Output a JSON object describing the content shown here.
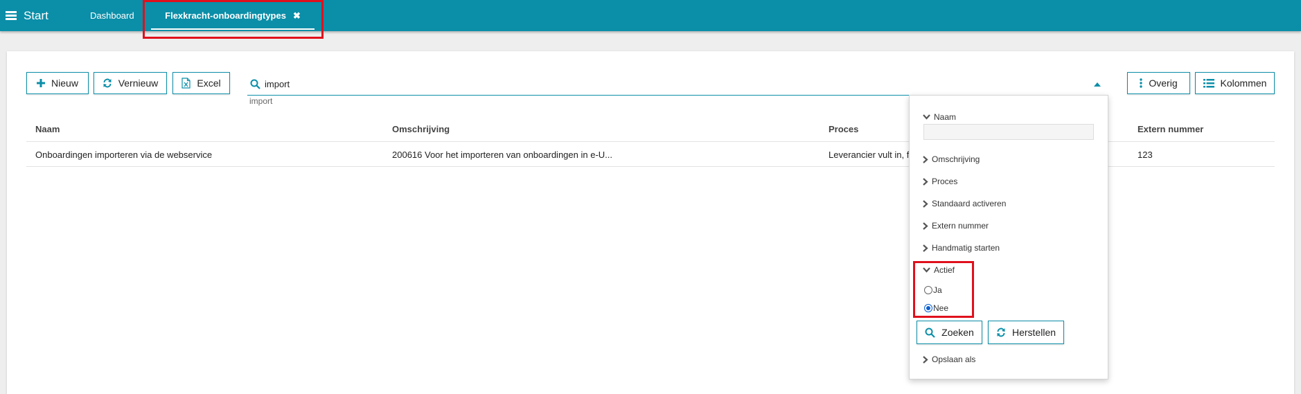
{
  "header": {
    "start_label": "Start",
    "tabs": [
      {
        "label": "Dashboard"
      },
      {
        "label": "Flexkracht-onboardingtypes",
        "close_icon": "✖"
      }
    ],
    "color": "#0b8ea8"
  },
  "toolbar": {
    "new_label": "Nieuw",
    "refresh_label": "Vernieuw",
    "excel_label": "Excel",
    "more_label": "Overig",
    "columns_label": "Kolommen"
  },
  "search": {
    "value": "import",
    "hint": "import"
  },
  "table": {
    "columns": [
      "Naam",
      "Omschrijving",
      "Proces",
      "Extern nummer"
    ],
    "rows": [
      {
        "naam": "Onboardingen importeren via de webservice",
        "omschrijving": "200616 Voor het importeren van onboardingen in e-U...",
        "proces": "Leverancier vult in, f",
        "extern_nummer": "123"
      }
    ]
  },
  "filter_panel": {
    "sections": [
      {
        "label": "Naam",
        "expanded": true
      },
      {
        "label": "Omschrijving",
        "expanded": false
      },
      {
        "label": "Proces",
        "expanded": false
      },
      {
        "label": "Standaard activeren",
        "expanded": false
      },
      {
        "label": "Extern nummer",
        "expanded": false
      },
      {
        "label": "Handmatig starten",
        "expanded": false
      },
      {
        "label": "Actief",
        "expanded": true
      }
    ],
    "actief_options": [
      {
        "label": "Ja",
        "checked": false
      },
      {
        "label": "Nee",
        "checked": true
      }
    ],
    "search_button": "Zoeken",
    "reset_button": "Herstellen",
    "save_as": "Opslaan als"
  },
  "highlight_color": "#e0101c"
}
